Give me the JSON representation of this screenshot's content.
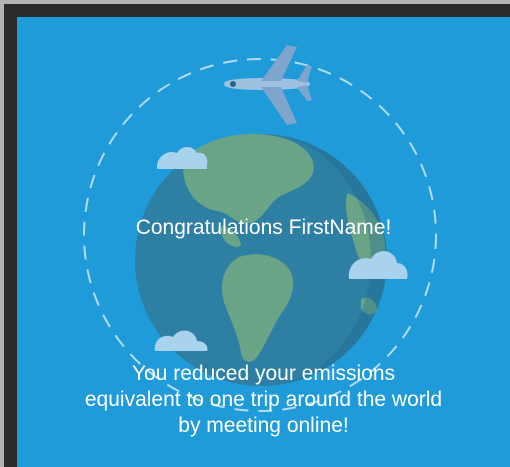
{
  "card": {
    "headline": "Congratulations FirstName!",
    "message_lines": [
      "You reduced your emissions",
      "equivalent to one trip around the world",
      "by meeting online!"
    ]
  },
  "colors": {
    "background": "#1f9bda",
    "ocean": "#2d7fa3",
    "land": "#6aa487",
    "cloud": "#a9d2ec",
    "plane": "#8fb4d6",
    "orbit": "#cfe6f5",
    "text": "#ffffff"
  },
  "icons": [
    "globe-illustration",
    "airplane-icon",
    "cloud-icon",
    "orbit-ring"
  ]
}
